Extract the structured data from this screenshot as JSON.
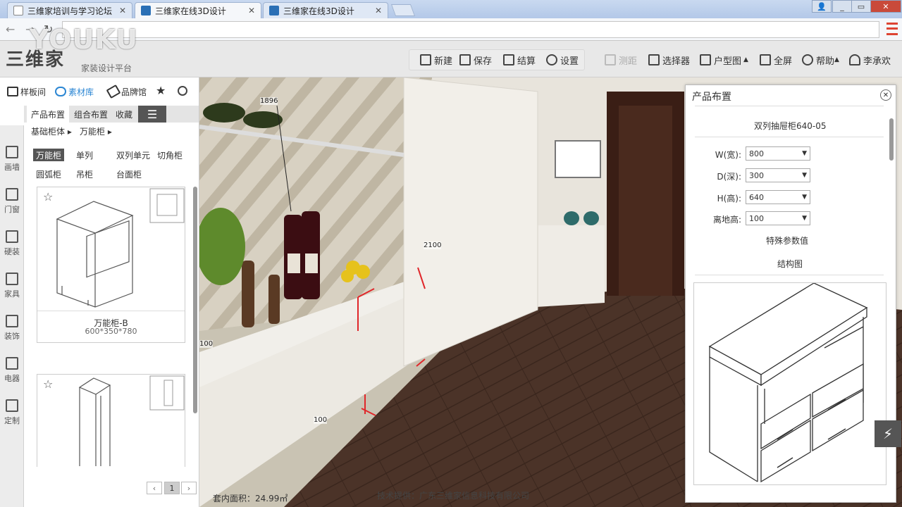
{
  "browser": {
    "tabs": [
      {
        "label": "三维家培训与学习论坛"
      },
      {
        "label": "三维家在线3D设计"
      },
      {
        "label": "三维家在线3D设计"
      }
    ]
  },
  "watermark": "YOUKU",
  "header": {
    "logo": "三维家",
    "subtitle": "家装设计平台",
    "toolbar": {
      "new": "新建",
      "save": "保存",
      "checkout": "结算",
      "settings": "设置",
      "measure": "测距",
      "selector": "选择器",
      "floorplan": "户型图",
      "fullscreen": "全屏",
      "help": "帮助",
      "user": "李承欢"
    }
  },
  "left": {
    "topnav": {
      "templates": "样板间",
      "materials": "素材库",
      "brands": "品牌馆"
    },
    "subtabs": [
      "产品布置",
      "组合布置",
      "收藏"
    ],
    "breadcrumb": [
      "基础柜体",
      "万能柜"
    ],
    "categories": [
      "万能柜",
      "单列",
      "双列单元",
      "切角柜",
      "圆弧柜",
      "吊柜",
      "台面柜"
    ],
    "sidebar": [
      "画墙",
      "门窗",
      "硬装",
      "家具",
      "装饰",
      "电器",
      "定制"
    ],
    "cards": [
      {
        "name": "万能柜-B",
        "size": "600*350*780"
      }
    ],
    "pagination": {
      "current": "1"
    }
  },
  "scene": {
    "area": "套内面积：24.99㎡",
    "credit": "技术提供：广东三维家信息科技有限公司",
    "dims": [
      "1896",
      "2100",
      "100",
      "100"
    ]
  },
  "right": {
    "title": "产品布置",
    "product_name": "双列抽屉柜640-05",
    "fields": [
      {
        "label": "W(宽):",
        "value": "800"
      },
      {
        "label": "D(深):",
        "value": "300"
      },
      {
        "label": "H(高):",
        "value": "640"
      },
      {
        "label": "离地高:",
        "value": "100"
      }
    ],
    "special_params": "特殊参数值",
    "structure": "结构图"
  }
}
